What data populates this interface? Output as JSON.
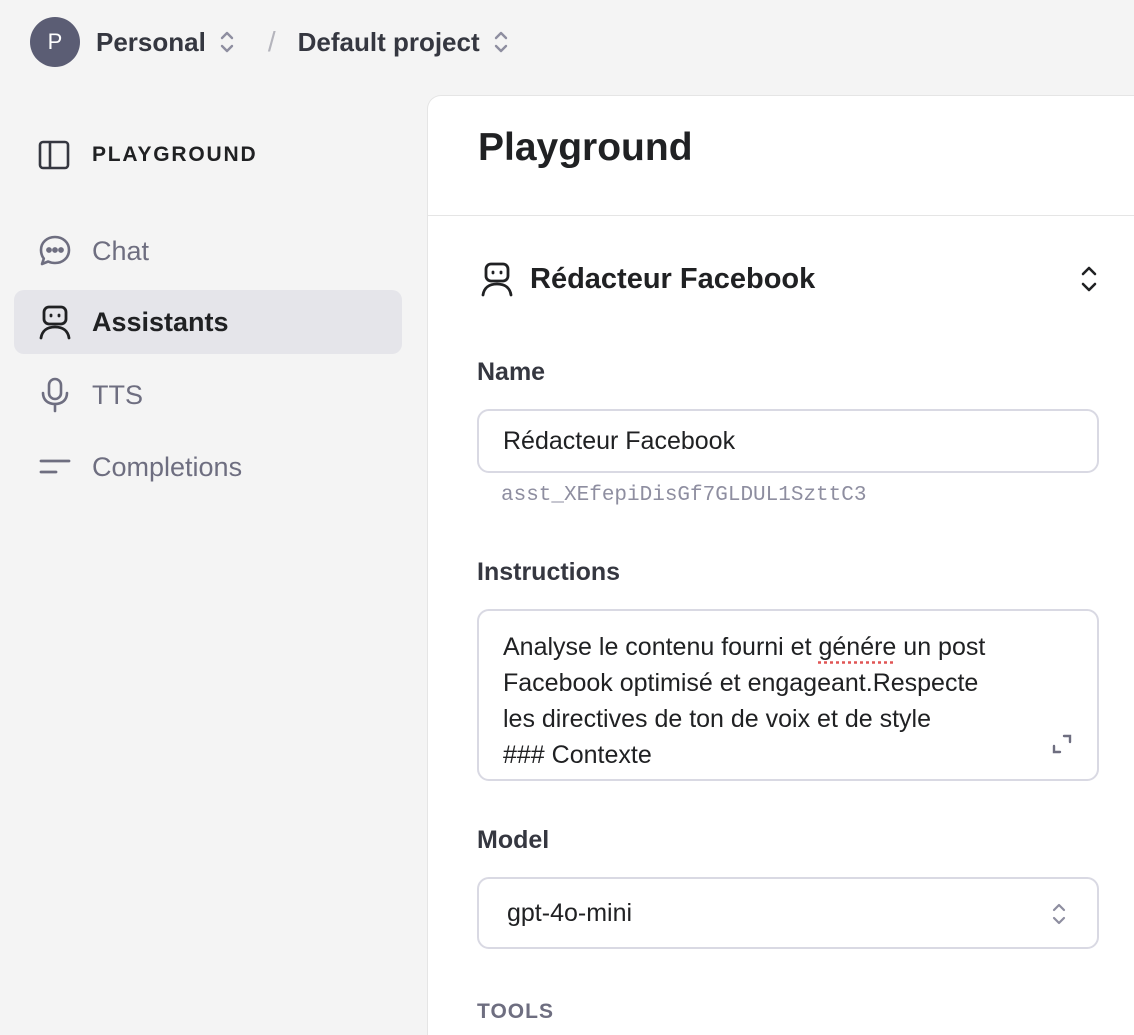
{
  "header": {
    "avatar_letter": "P",
    "org": "Personal",
    "project": "Default project",
    "separator": "/"
  },
  "sidebar": {
    "title": "PLAYGROUND",
    "items": [
      {
        "label": "Chat",
        "icon": "chat-bubble-icon",
        "active": false
      },
      {
        "label": "Assistants",
        "icon": "robot-icon",
        "active": true
      },
      {
        "label": "TTS",
        "icon": "microphone-icon",
        "active": false
      },
      {
        "label": "Completions",
        "icon": "text-lines-icon",
        "active": false
      }
    ]
  },
  "main": {
    "title": "Playground",
    "assistant_selector": "Rédacteur Facebook",
    "name_label": "Name",
    "name_value": "Rédacteur Facebook",
    "assistant_id": "asst_XEfepiDisGf7GLDUL1SzttC3",
    "instructions_label": "Instructions",
    "instructions_parts": [
      "Analyse le contenu fourni et ",
      "génére",
      " un post\nFacebook optimisé et engageant.Respecte\nles directives de ton de voix et de style\n### Contexte\nCet assistant l'Agent a pour mission de"
    ],
    "model_label": "Model",
    "model_value": "gpt-4o-mini",
    "tools_label": "TOOLS"
  },
  "colors": {
    "background": "#f4f4f4",
    "panel": "#ffffff",
    "active_nav": "#e5e5ea",
    "avatar": "#5b5d74",
    "muted_text": "#6e6e80",
    "border": "#d9d9e3"
  }
}
